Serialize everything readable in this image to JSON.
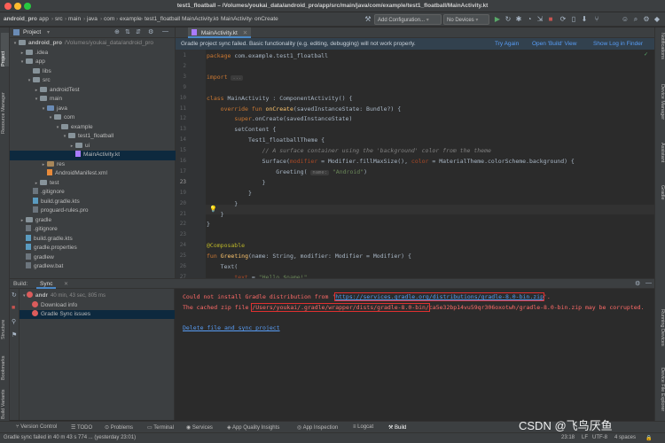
{
  "window": {
    "title": "test1_floatball – /Volumes/youkai_data/android_pro/app/src/main/java/com/example/test1_floatball/MainActivity.kt"
  },
  "navbar": {
    "breadcrumbs": [
      "android_pro",
      "app",
      "src",
      "main",
      "java",
      "com",
      "example",
      "test1_floatball",
      "MainActivity.kt",
      "MainActivity",
      "onCreate"
    ],
    "add_config": "Add Configuration...",
    "no_devices": "No Devices"
  },
  "left_stripe": [
    "Project",
    "Resource Manager"
  ],
  "left_stripe_bottom": [
    "Structure",
    "Bookmarks",
    "Build Variants"
  ],
  "right_stripe": [
    "Notifications",
    "Device Manager",
    "Assistant",
    "Gradle",
    "Running Devices",
    "Device File Explorer",
    "Emulator"
  ],
  "project": {
    "header": "Project",
    "tree": [
      {
        "label": "android_pro",
        "extra": "/Volumes/youkai_data/android_pro",
        "depth": 0,
        "kind": "folder",
        "arrow": "▾"
      },
      {
        "label": ".idea",
        "depth": 1,
        "kind": "folder",
        "arrow": "▸"
      },
      {
        "label": "app",
        "depth": 1,
        "kind": "folder",
        "arrow": "▾"
      },
      {
        "label": "libs",
        "depth": 2,
        "kind": "folder",
        "arrow": ""
      },
      {
        "label": "src",
        "depth": 2,
        "kind": "folder",
        "arrow": "▾"
      },
      {
        "label": "androidTest",
        "depth": 3,
        "kind": "folder",
        "arrow": "▸"
      },
      {
        "label": "main",
        "depth": 3,
        "kind": "folder",
        "arrow": "▾"
      },
      {
        "label": "java",
        "depth": 4,
        "kind": "folder-blue",
        "arrow": "▾"
      },
      {
        "label": "com",
        "depth": 5,
        "kind": "folder",
        "arrow": "▾"
      },
      {
        "label": "example",
        "depth": 6,
        "kind": "folder",
        "arrow": "▾"
      },
      {
        "label": "test1_floatball",
        "depth": 7,
        "kind": "folder",
        "arrow": "▾"
      },
      {
        "label": "ui",
        "depth": 8,
        "kind": "folder",
        "arrow": "▸"
      },
      {
        "label": "MainActivity.kt",
        "depth": 8,
        "kind": "kt",
        "arrow": "",
        "selected": true
      },
      {
        "label": "res",
        "depth": 4,
        "kind": "folder-brown",
        "arrow": "▸"
      },
      {
        "label": "AndroidManifest.xml",
        "depth": 4,
        "kind": "xml",
        "arrow": ""
      },
      {
        "label": "test",
        "depth": 3,
        "kind": "folder",
        "arrow": "▸"
      },
      {
        "label": ".gitignore",
        "depth": 2,
        "kind": "file",
        "arrow": ""
      },
      {
        "label": "build.gradle.kts",
        "depth": 2,
        "kind": "gradle",
        "arrow": ""
      },
      {
        "label": "proguard-rules.pro",
        "depth": 2,
        "kind": "file",
        "arrow": ""
      },
      {
        "label": "gradle",
        "depth": 1,
        "kind": "folder",
        "arrow": "▸"
      },
      {
        "label": ".gitignore",
        "depth": 1,
        "kind": "file",
        "arrow": ""
      },
      {
        "label": "build.gradle.kts",
        "depth": 1,
        "kind": "gradle",
        "arrow": ""
      },
      {
        "label": "gradle.properties",
        "depth": 1,
        "kind": "gradle",
        "arrow": ""
      },
      {
        "label": "gradlew",
        "depth": 1,
        "kind": "file",
        "arrow": ""
      },
      {
        "label": "gradlew.bat",
        "depth": 1,
        "kind": "file",
        "arrow": ""
      }
    ]
  },
  "editor": {
    "tab": "MainActivity.kt",
    "banner": "Gradle project sync failed. Basic functionality (e.g. editing, debugging) will not work properly.",
    "banner_links": [
      "Try Again",
      "Open 'Build' View",
      "Show Log in Finder"
    ],
    "lines": [
      {
        "n": "1",
        "html": "<span class=\"kw\">package</span> com.example.test1_floatball"
      },
      {
        "n": "2",
        "html": ""
      },
      {
        "n": "3",
        "html": "<span class=\"kw\">import</span> <span class=\"hint\">...</span>"
      },
      {
        "n": "9",
        "html": ""
      },
      {
        "n": "10",
        "html": "<span class=\"kw\">class</span> MainActivity : ComponentActivity() {"
      },
      {
        "n": "11",
        "html": "    <span class=\"kw\">override fun</span> <span class=\"fn\">onCreate</span>(savedInstanceState: Bundle?) {"
      },
      {
        "n": "12",
        "html": "        <span class=\"kw\">super</span>.onCreate(savedInstanceState)"
      },
      {
        "n": "13",
        "html": "        setContent {"
      },
      {
        "n": "14",
        "html": "            Test1_floatballTheme {"
      },
      {
        "n": "15",
        "html": "                <span class=\"cm\">// A surface container using the 'background' color from the theme</span>"
      },
      {
        "n": "16",
        "html": "                Surface(<span class=\"param\">modifier</span> = Modifier.fillMaxSize(), <span class=\"param\">color</span> = MaterialTheme.colorScheme.background) {"
      },
      {
        "n": "17",
        "html": "                    Greeting( <span class=\"hint\">name:</span> <span class=\"str\">\"Android\"</span>)"
      },
      {
        "n": "23",
        "html": "                }"
      },
      {
        "n": "19",
        "html": "            }"
      },
      {
        "n": "20",
        "html": "        }"
      },
      {
        "n": "21",
        "html": "    }"
      },
      {
        "n": "22",
        "html": "}"
      },
      {
        "n": "23",
        "html": ""
      },
      {
        "n": "24",
        "html": "<span class=\"ann\">@Composable</span>"
      },
      {
        "n": "25",
        "html": "<span class=\"kw\">fun</span> <span class=\"fn\">Greeting</span>(name: String, modifier: Modifier = Modifier) {"
      },
      {
        "n": "26",
        "html": "    Text("
      },
      {
        "n": "27",
        "html": "        <span class=\"param\">text</span> = <span class=\"str\">\"Hello $name!\"</span>,"
      }
    ]
  },
  "build": {
    "label": "Build:",
    "tab": "Sync",
    "tree": [
      {
        "label": "andr",
        "extra": "40 min, 43 sec, 805 ms",
        "depth": 0,
        "error": true
      },
      {
        "label": "Download info",
        "depth": 1,
        "error": true
      },
      {
        "label": "Gradle Sync issues",
        "depth": 1,
        "error": true,
        "selected": true
      }
    ],
    "output": {
      "line1_prefix": "Could not install Gradle distribution from '",
      "line1_url": "https://services.gradle.org/distributions/gradle-8.0-bin.zip",
      "line1_suffix": "'.",
      "line2_prefix": "The cached zip file ",
      "line2_path": "/Users/youkai/.gradle/wrapper/dists/gradle-8.0-bin/",
      "line2_suffix": "ca5e32bp14vu59qr306oxotwh/gradle-8.0-bin.zip may be corrupted.",
      "link": "Delete file and sync project"
    }
  },
  "toolwindows": [
    "Version Control",
    "TODO",
    "Problems",
    "Terminal",
    "Services",
    "App Quality Insights",
    "App Inspection",
    "Logcat",
    "Build"
  ],
  "status": {
    "left": "Gradle sync failed in 40 m 43 s 774 ... (yesterday 23:01)",
    "position": "23:18",
    "line_sep": "LF",
    "encoding": "UTF-8",
    "indent": "4 spaces"
  },
  "watermark": "CSDN @飞鸟厌鱼",
  "colors": {
    "accent": "#4a88c7",
    "error": "#ff6b68",
    "link": "#589df6",
    "selection": "#0d293e"
  }
}
